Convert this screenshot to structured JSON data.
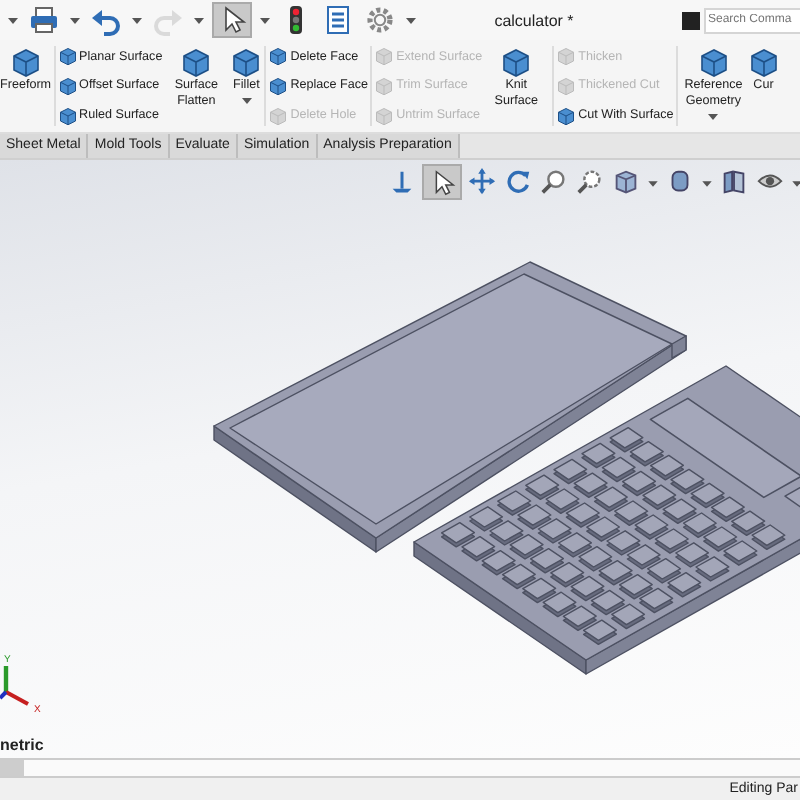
{
  "quick_access": [
    {
      "kind": "caret",
      "selected": false,
      "disabled": false
    },
    {
      "kind": "print",
      "selected": false,
      "disabled": false
    },
    {
      "kind": "caret",
      "selected": false,
      "disabled": false
    },
    {
      "kind": "undo",
      "selected": false,
      "disabled": false
    },
    {
      "kind": "caret",
      "selected": false,
      "disabled": false
    },
    {
      "kind": "redo",
      "selected": false,
      "disabled": true
    },
    {
      "kind": "caret",
      "selected": false,
      "disabled": false
    },
    {
      "kind": "select",
      "selected": true,
      "disabled": false
    },
    {
      "kind": "caret",
      "selected": false,
      "disabled": false
    },
    {
      "kind": "light",
      "selected": false,
      "disabled": false
    },
    {
      "kind": "list",
      "selected": false,
      "disabled": false
    },
    {
      "kind": "gear",
      "selected": false,
      "disabled": false
    },
    {
      "kind": "caret",
      "selected": false,
      "disabled": false
    }
  ],
  "window": {
    "title": "calculator *"
  },
  "search": {
    "placeholder": "Search Comma"
  },
  "ribbon": {
    "groups": [
      {
        "kind": "large",
        "divider_after": true,
        "items": [
          {
            "label": "Freeform",
            "disabled": false,
            "dropdown": false
          }
        ]
      },
      {
        "kind": "stack",
        "divider_after": false,
        "items": [
          {
            "label": "Planar Surface",
            "disabled": false
          },
          {
            "label": "Offset Surface",
            "disabled": false
          },
          {
            "label": "Ruled Surface",
            "disabled": false
          }
        ]
      },
      {
        "kind": "large",
        "divider_after": false,
        "items": [
          {
            "label": "Surface Flatten",
            "disabled": false,
            "dropdown": false
          }
        ]
      },
      {
        "kind": "large",
        "divider_after": true,
        "items": [
          {
            "label": "Fillet",
            "disabled": false,
            "dropdown": true
          }
        ]
      },
      {
        "kind": "stack",
        "divider_after": true,
        "items": [
          {
            "label": "Delete Face",
            "disabled": false
          },
          {
            "label": "Replace Face",
            "disabled": false
          },
          {
            "label": "Delete Hole",
            "disabled": true
          }
        ]
      },
      {
        "kind": "stack",
        "divider_after": false,
        "items": [
          {
            "label": "Extend Surface",
            "disabled": true
          },
          {
            "label": "Trim Surface",
            "disabled": true
          },
          {
            "label": "Untrim Surface",
            "disabled": true
          }
        ]
      },
      {
        "kind": "large",
        "divider_after": true,
        "items": [
          {
            "label": "Knit Surface",
            "disabled": false,
            "dropdown": false
          }
        ]
      },
      {
        "kind": "stack",
        "divider_after": true,
        "items": [
          {
            "label": "Thicken",
            "disabled": true
          },
          {
            "label": "Thickened Cut",
            "disabled": true
          },
          {
            "label": "Cut With Surface",
            "disabled": false
          }
        ]
      },
      {
        "kind": "large",
        "divider_after": false,
        "items": [
          {
            "label": "Reference Geometry",
            "disabled": false,
            "dropdown": true
          }
        ]
      },
      {
        "kind": "large",
        "divider_after": false,
        "items": [
          {
            "label": "Cur",
            "disabled": false,
            "dropdown": false
          }
        ]
      }
    ]
  },
  "tabs": [
    {
      "label": "Sheet Metal",
      "selected": false
    },
    {
      "label": "Mold Tools",
      "selected": false
    },
    {
      "label": "Evaluate",
      "selected": false
    },
    {
      "label": "Simulation",
      "selected": false
    },
    {
      "label": "Analysis Preparation",
      "selected": false
    }
  ],
  "view_toolbar": [
    {
      "kind": "normal",
      "selected": false
    },
    {
      "kind": "select",
      "selected": true
    },
    {
      "kind": "pan",
      "selected": false
    },
    {
      "kind": "rotate",
      "selected": false
    },
    {
      "kind": "zoom",
      "selected": false
    },
    {
      "kind": "zoom-area",
      "selected": false
    },
    {
      "kind": "cube",
      "selected": false
    },
    {
      "kind": "caret",
      "selected": false
    },
    {
      "kind": "shaded",
      "selected": false
    },
    {
      "kind": "caret",
      "selected": false
    },
    {
      "kind": "section",
      "selected": false
    },
    {
      "kind": "eye",
      "selected": false
    },
    {
      "kind": "caret",
      "selected": false
    }
  ],
  "triad": {
    "y_label": "Y",
    "x_label": "X"
  },
  "view_name": "netric",
  "status_bar": {
    "text": "Editing Par"
  }
}
